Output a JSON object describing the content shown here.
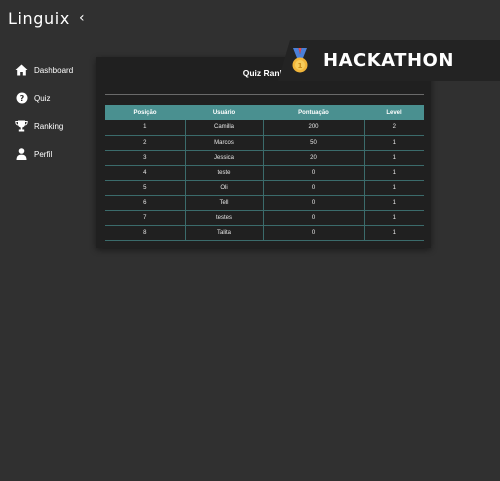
{
  "app": {
    "brand": "Linguix",
    "collapse_glyph": "‹"
  },
  "sidebar": {
    "items": [
      {
        "label": "Dashboard",
        "icon": "home-icon"
      },
      {
        "label": "Quiz",
        "icon": "question-icon"
      },
      {
        "label": "Ranking",
        "icon": "trophy-icon"
      },
      {
        "label": "Perfil",
        "icon": "user-icon"
      }
    ]
  },
  "ranking": {
    "title": "Quiz Rank",
    "columns": [
      "Posição",
      "Usuário",
      "Pontuação",
      "Level"
    ],
    "rows": [
      [
        "1",
        "Camilla",
        "200",
        "2"
      ],
      [
        "2",
        "Marcos",
        "50",
        "1"
      ],
      [
        "3",
        "Jessica",
        "20",
        "1"
      ],
      [
        "4",
        "teste",
        "0",
        "1"
      ],
      [
        "5",
        "Oli",
        "0",
        "1"
      ],
      [
        "6",
        "Tell",
        "0",
        "1"
      ],
      [
        "7",
        "testes",
        "0",
        "1"
      ],
      [
        "8",
        "Talita",
        "0",
        "1"
      ]
    ]
  },
  "banner": {
    "text": "HACKATHON",
    "icon": "medal-icon"
  },
  "colors": {
    "background": "#303030",
    "panel": "#202020",
    "table_header": "#4a9090",
    "banner": "#232323"
  }
}
